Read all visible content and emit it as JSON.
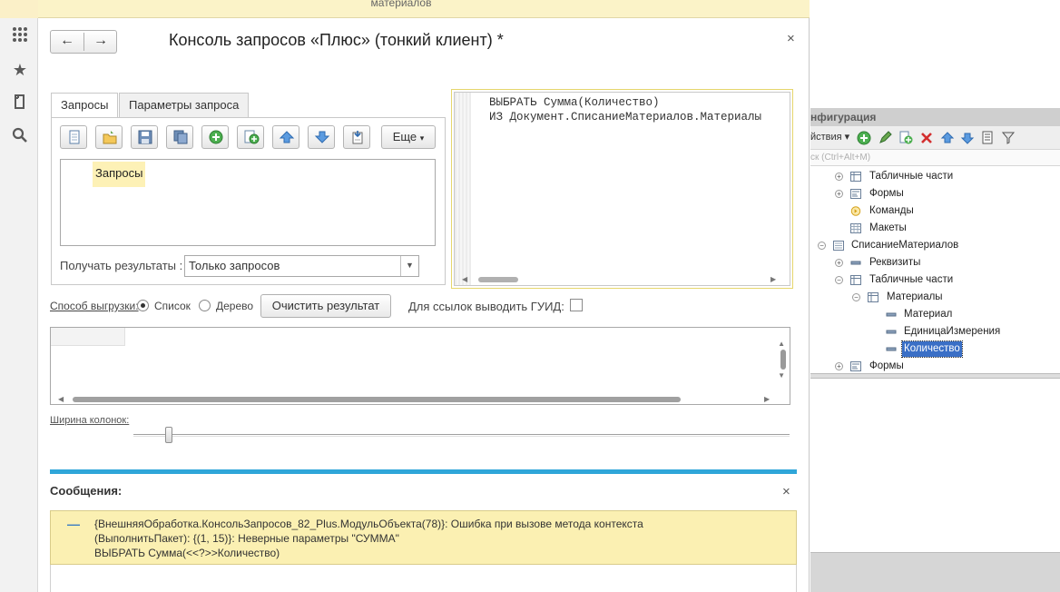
{
  "window": {
    "top_band_text": "материалов",
    "title": "Консоль запросов «Плюс» (тонкий клиент) *",
    "nav_back": "←",
    "nav_forward": "→",
    "close": "×"
  },
  "rail": {
    "icons": [
      "apps-grid-icon",
      "star-icon",
      "history-icon",
      "search-icon"
    ]
  },
  "tabs": [
    {
      "label": "Запросы",
      "active": true
    },
    {
      "label": "Параметры запроса",
      "active": false
    }
  ],
  "toolbar": {
    "buttons": [
      "new-icon",
      "open-folder-icon",
      "save-icon",
      "copy-icon",
      "add-icon",
      "add-child-icon",
      "move-up-icon",
      "move-down-icon",
      "import-icon"
    ],
    "more_label": "Еще"
  },
  "queries_tree": {
    "item": "Запросы"
  },
  "get_results": {
    "label": "Получать результаты :",
    "value": "Только запросов"
  },
  "editor": {
    "lines": [
      "ВЫБРАТЬ Сумма(Количество)",
      "ИЗ Документ.СписаниеМатериалов.Материалы"
    ]
  },
  "export": {
    "label": "Способ выгрузки:",
    "option_list": "Список",
    "option_tree": "Дерево",
    "selected": "Список",
    "clear_button": "Очистить результат",
    "guid_label": "Для ссылок выводить ГУИД:",
    "guid_checked": false
  },
  "column_width": {
    "label": "Ширина колонок:"
  },
  "messages": {
    "title": "Сообщения:",
    "close": "×",
    "lines": [
      "{ВнешняяОбработка.КонсольЗапросов_82_Plus.МодульОбъекта(78)}: Ошибка при вызове метода контекста",
      "(ВыполнитьПакет): {(1, 15)}: Неверные параметры \"СУММА\"",
      "ВЫБРАТЬ Сумма(<<?>>Количество)"
    ]
  },
  "configurator": {
    "header": "нфигурация",
    "actions_label": "йствия ▾",
    "search_placeholder": "ск (Ctrl+Alt+M)",
    "tree": [
      {
        "label": "Табличные части",
        "indent": 1,
        "toggle": "+",
        "icon": "table-icon"
      },
      {
        "label": "Формы",
        "indent": 1,
        "toggle": "+",
        "icon": "form-icon"
      },
      {
        "label": "Команды",
        "indent": 1,
        "toggle": "",
        "icon": "command-icon"
      },
      {
        "label": "Макеты",
        "indent": 1,
        "toggle": "",
        "icon": "template-icon"
      },
      {
        "label": "СписаниеМатериалов",
        "indent": 0,
        "toggle": "−",
        "icon": "document-icon"
      },
      {
        "label": "Реквизиты",
        "indent": 1,
        "toggle": "+",
        "icon": "attribute-icon"
      },
      {
        "label": "Табличные части",
        "indent": 1,
        "toggle": "−",
        "icon": "table-icon"
      },
      {
        "label": "Материалы",
        "indent": 2,
        "toggle": "−",
        "icon": "table-icon"
      },
      {
        "label": "Материал",
        "indent": 3,
        "toggle": "",
        "icon": "attribute-icon"
      },
      {
        "label": "ЕдиницаИзмерения",
        "indent": 3,
        "toggle": "",
        "icon": "attribute-icon"
      },
      {
        "label": "Количество",
        "indent": 3,
        "toggle": "",
        "icon": "attribute-icon",
        "selected": true
      },
      {
        "label": "Формы",
        "indent": 1,
        "toggle": "+",
        "icon": "form-icon"
      }
    ]
  },
  "colors": {
    "accent_blue": "#2fa6d9",
    "message_yellow": "#fbf0b2",
    "highlight_yellow": "#fdf1b6",
    "selection_blue": "#3a6fc6"
  }
}
